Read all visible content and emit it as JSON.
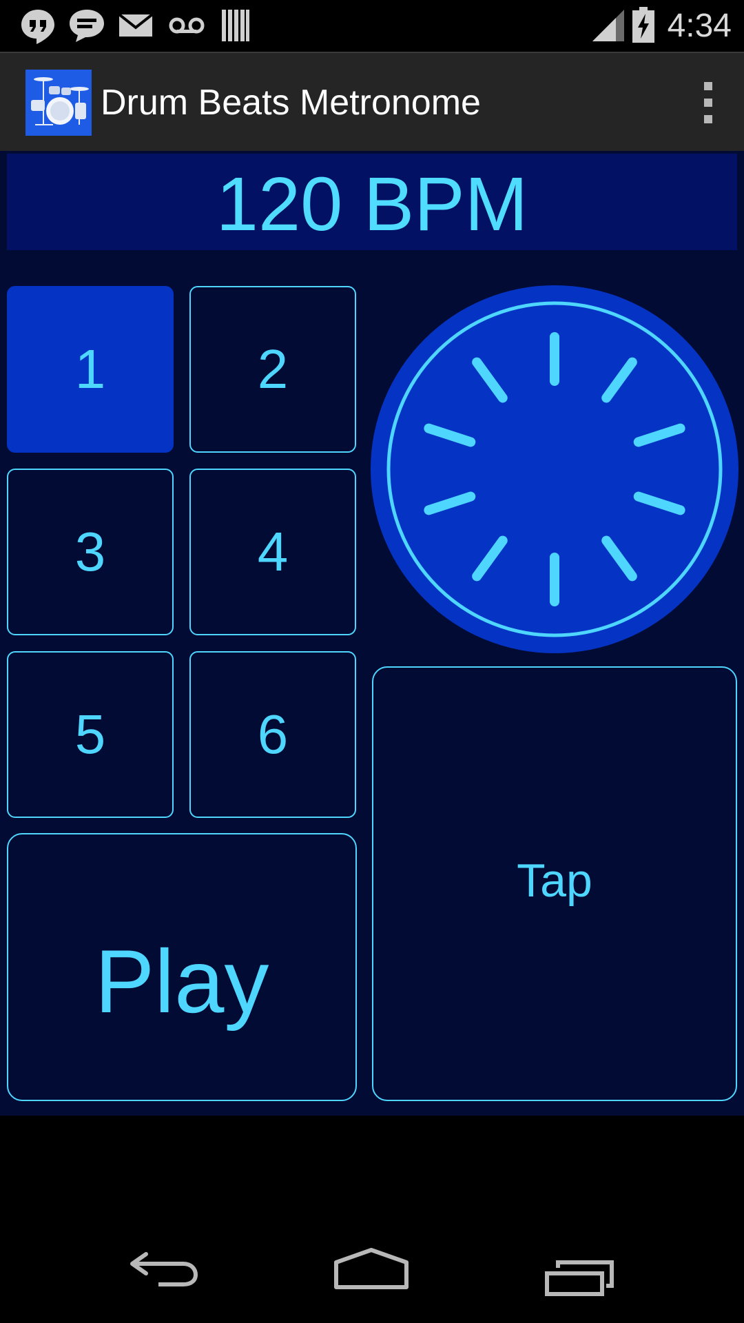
{
  "status_bar": {
    "time": "4:34",
    "icons": [
      "hangouts-icon",
      "sms-icon",
      "gmail-icon",
      "voicemail-icon",
      "barcode-icon",
      "signal-icon",
      "battery-charging-icon"
    ]
  },
  "action_bar": {
    "title": "Drum Beats Metronome",
    "app_icon": "drum-kit-icon",
    "overflow_icon": "overflow-menu-icon"
  },
  "tempo": {
    "display": "120 BPM"
  },
  "beats": {
    "selected": "1",
    "buttons": [
      "1",
      "2",
      "3",
      "4",
      "5",
      "6"
    ]
  },
  "controls": {
    "play_label": "Play",
    "tap_label": "Tap"
  },
  "dial": {
    "icon": "tempo-dial-icon"
  },
  "colors": {
    "background": "#020b33",
    "accent": "#4fd6ff",
    "active": "#0534c4",
    "bpm_panel": "#021164"
  },
  "nav_bar": {
    "buttons": [
      "back-icon",
      "home-icon",
      "recents-icon"
    ]
  }
}
